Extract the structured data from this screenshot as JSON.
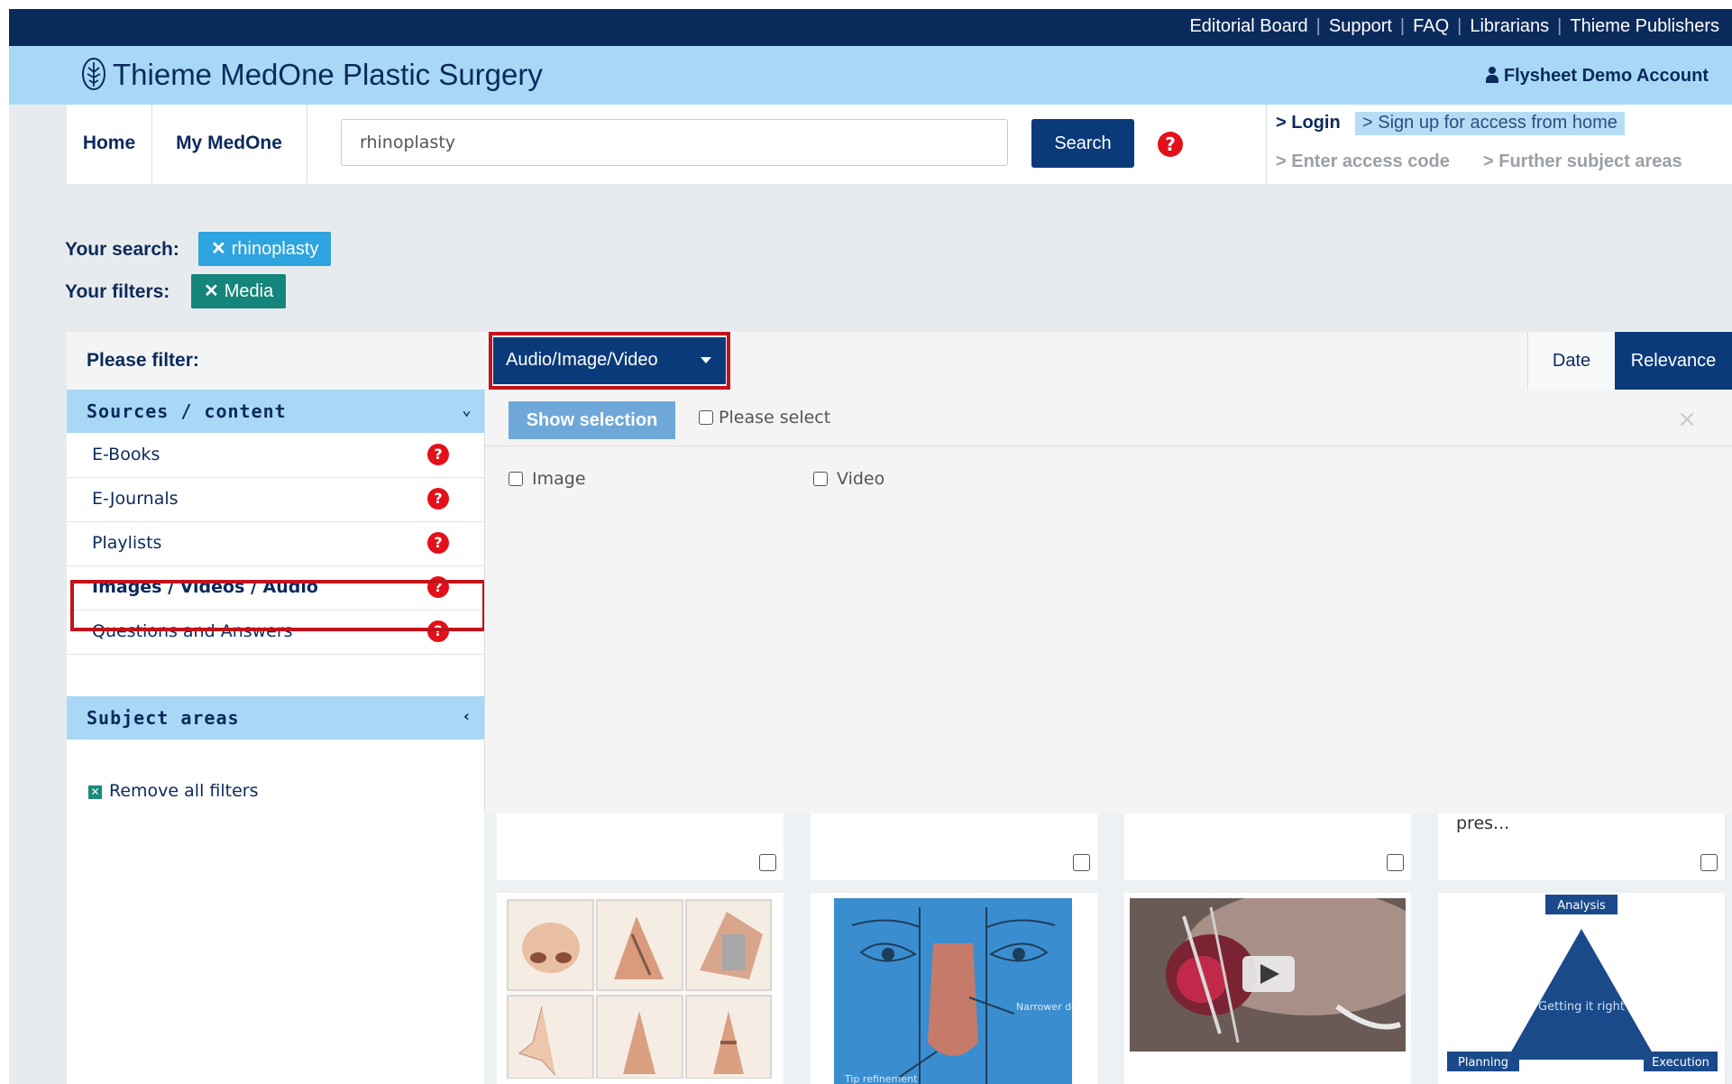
{
  "topbar": {
    "links": [
      "Editorial Board",
      "Support",
      "FAQ",
      "Librarians",
      "Thieme Publishers"
    ]
  },
  "brand": {
    "name_part1": "Thieme ",
    "name_part2": "MedOne Plastic Surgery",
    "account": "Flysheet Demo Account"
  },
  "nav": {
    "home": "Home",
    "my_medone": "My MedOne",
    "search_value": "rhinoplasty",
    "search_button": "Search",
    "help_glyph": "?",
    "login": "> Login",
    "signup": "> Sign up for access from home",
    "access_code": "> Enter access code",
    "further": "> Further subject areas"
  },
  "summary": {
    "your_search_label": "Your search:",
    "search_chip": "rhinoplasty",
    "your_filters_label": "Your filters:",
    "filter_chip": "Media",
    "chip_x": "✕"
  },
  "filters": {
    "please_filter": "Please filter:",
    "sources_title": "Sources / content",
    "sources": [
      {
        "label": "E-Books"
      },
      {
        "label": "E-Journals"
      },
      {
        "label": "Playlists"
      },
      {
        "label": "Images / Videos / Audio"
      },
      {
        "label": "Questions and Answers"
      }
    ],
    "subject_title": "Subject areas",
    "remove_all": "Remove all filters",
    "chevron_down": "⌄",
    "chevron_left": "‹"
  },
  "results_toolbar": {
    "type_dropdown": "Audio/Image/Video",
    "date": "Date",
    "relevance": "Relevance"
  },
  "dropdown": {
    "show_selection": "Show selection",
    "please_select": "Please select",
    "close": "×",
    "options": [
      "Image",
      "Video"
    ]
  },
  "results": {
    "snippet": "pres...",
    "diagram": {
      "top": "Analysis",
      "center": "Getting it right",
      "left": "Planning",
      "right": "Execution"
    },
    "nose_labels": {
      "right": "Narrower dorsum",
      "left": "Tip refinement"
    }
  },
  "colors": {
    "navy": "#0b2a5c",
    "brand_blue": "#a8d8f5",
    "button_blue": "#0b3a7a",
    "chip_blue": "#2ea4e0",
    "chip_teal": "#13857a",
    "highlight_red": "#c4121b",
    "help_red": "#e3101a"
  }
}
